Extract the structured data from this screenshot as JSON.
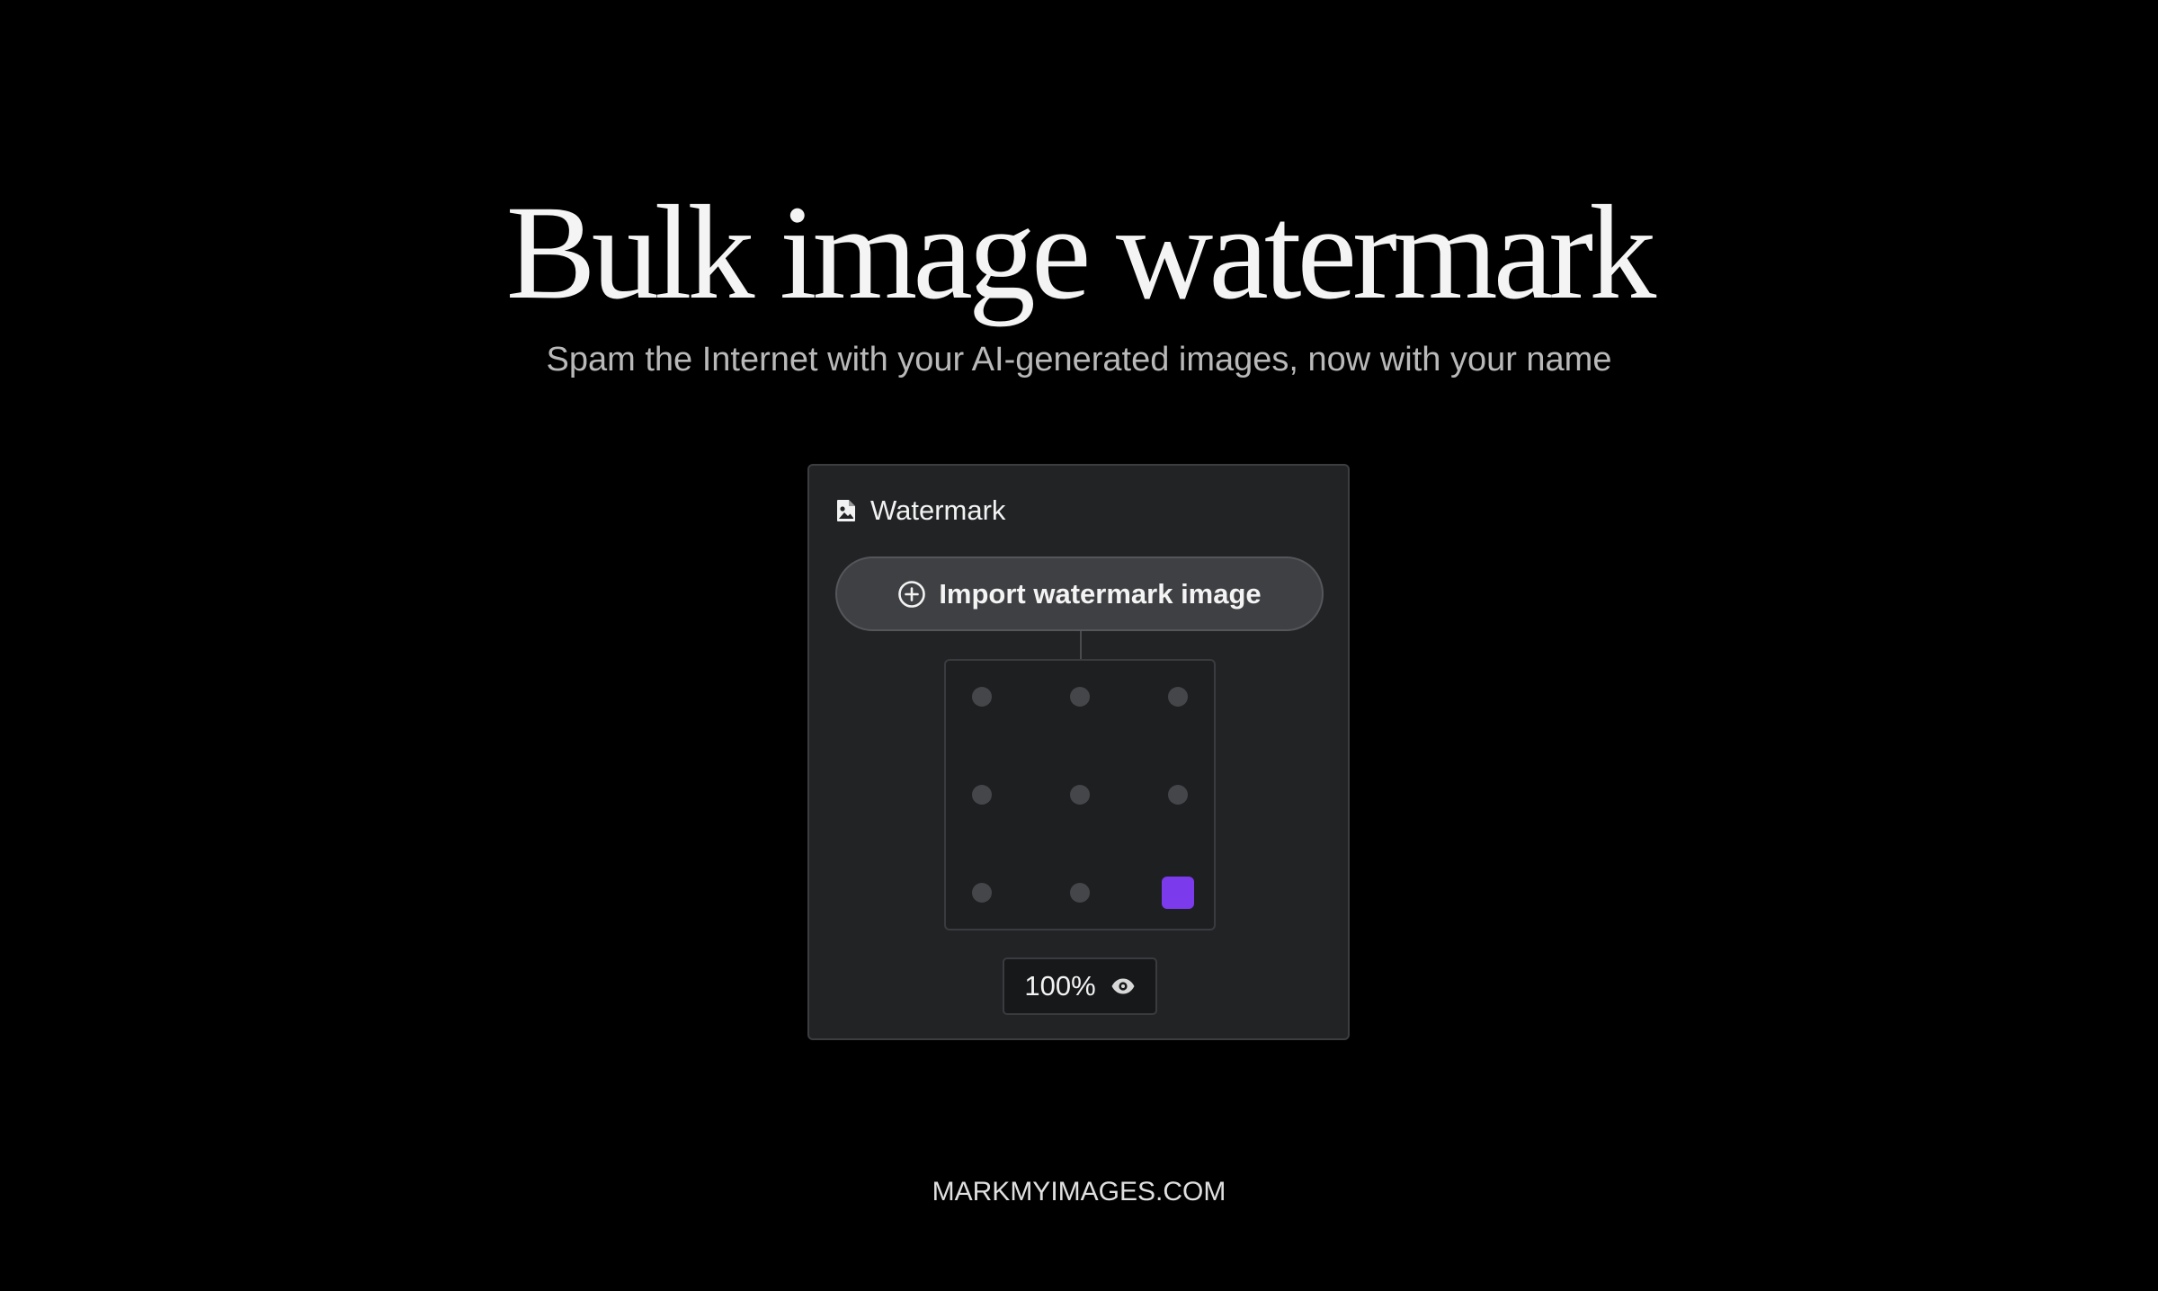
{
  "hero": {
    "title": "Bulk image watermark",
    "subtitle": "Spam the Internet with your AI-generated images, now with your name"
  },
  "panel": {
    "title": "Watermark",
    "title_icon": "image-file-icon",
    "import_button": {
      "label": "Import watermark image",
      "icon": "plus-circle-icon"
    },
    "position_grid": {
      "rows": 3,
      "columns": 3,
      "positions": [
        "top-left",
        "top-center",
        "top-right",
        "middle-left",
        "middle-center",
        "middle-right",
        "bottom-left",
        "bottom-center",
        "bottom-right"
      ],
      "selected": "bottom-right"
    },
    "opacity": {
      "value": "100%",
      "icon": "eye-icon"
    }
  },
  "footer": {
    "site": "MARKMYIMAGES.COM"
  },
  "colors": {
    "background": "#000000",
    "panel": "#222325",
    "accent": "#7c3aed",
    "button": "#3f4043"
  }
}
